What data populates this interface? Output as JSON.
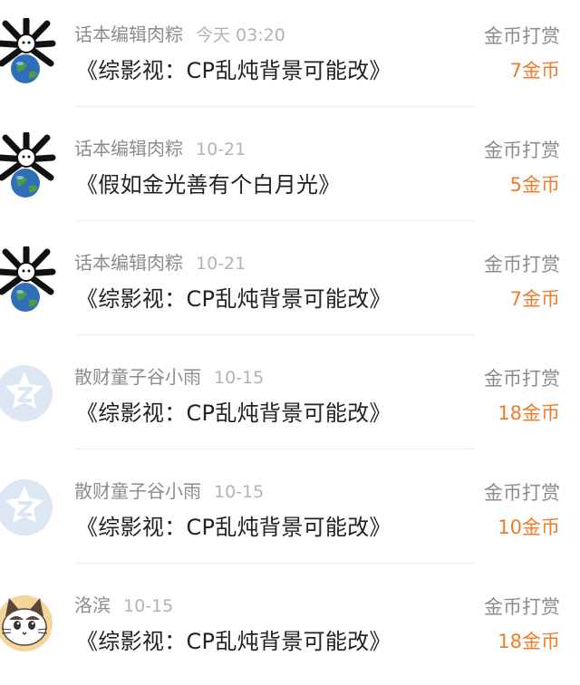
{
  "items": [
    {
      "name": "话本编辑肉粽",
      "time": "今天 03:20",
      "title": "《综影视：CP乱炖背景可能改》",
      "label": "金币打赏",
      "amount": "7金币",
      "avatar": "editor-avatar-icon"
    },
    {
      "name": "话本编辑肉粽",
      "time": "10-21",
      "title": "《假如金光善有个白月光》",
      "label": "金币打赏",
      "amount": "5金币",
      "avatar": "editor-avatar-icon"
    },
    {
      "name": "话本编辑肉粽",
      "time": "10-21",
      "title": "《综影视：CP乱炖背景可能改》",
      "label": "金币打赏",
      "amount": "7金币",
      "avatar": "editor-avatar-icon"
    },
    {
      "name": "散财童子谷小雨",
      "time": "10-15",
      "title": "《综影视：CP乱炖背景可能改》",
      "label": "金币打赏",
      "amount": "18金币",
      "avatar": "default-avatar-icon"
    },
    {
      "name": "散财童子谷小雨",
      "time": "10-15",
      "title": "《综影视：CP乱炖背景可能改》",
      "label": "金币打赏",
      "amount": "10金币",
      "avatar": "default-avatar-icon"
    },
    {
      "name": "洛滨",
      "time": "10-15",
      "title": "《综影视：CP乱炖背景可能改》",
      "label": "金币打赏",
      "amount": "18金币",
      "avatar": "cat-avatar-icon"
    }
  ]
}
